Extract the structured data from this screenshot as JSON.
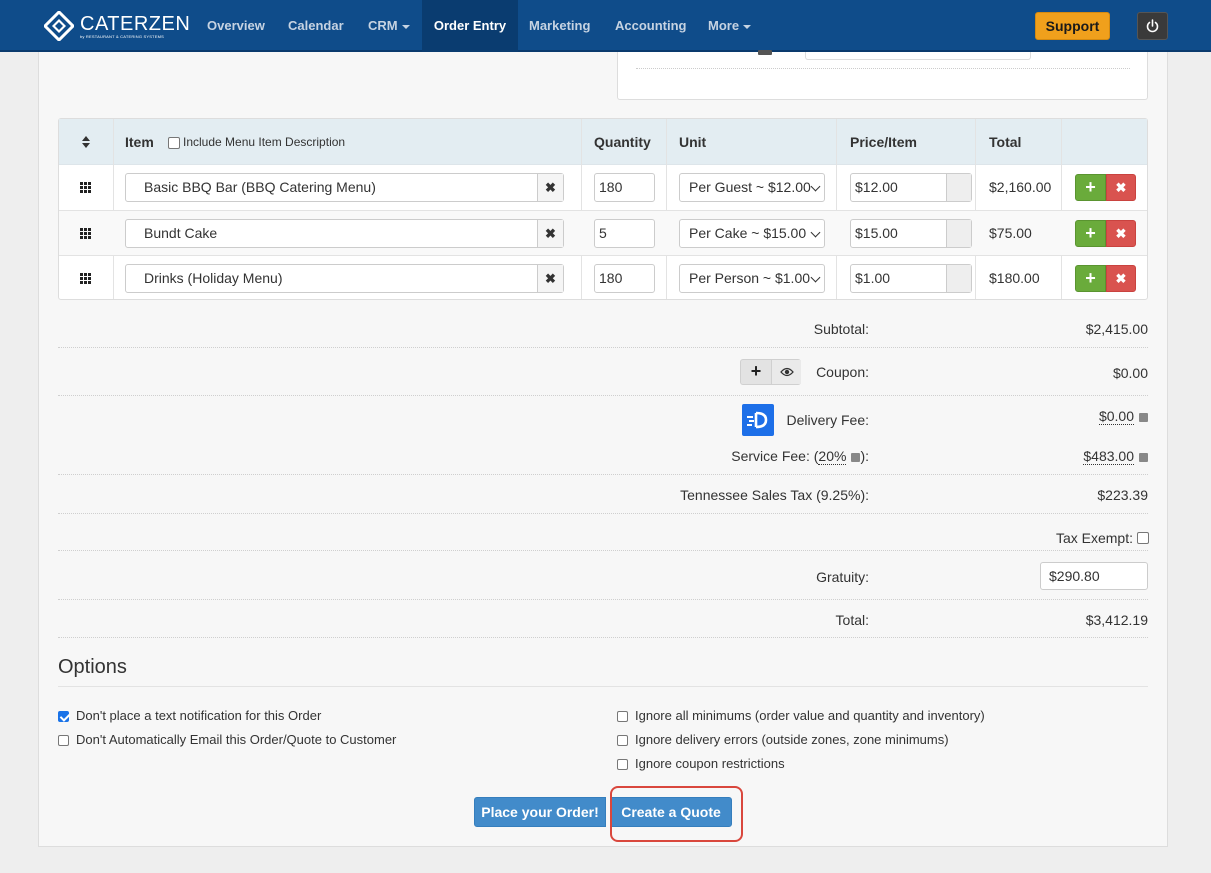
{
  "nav": {
    "brand": "CATERZEN",
    "brand_sub": "by RESTAURANT & CATERING SYSTEMS",
    "items": [
      {
        "label": "Overview"
      },
      {
        "label": "Calendar"
      },
      {
        "label": "CRM"
      },
      {
        "label": "Order Entry"
      },
      {
        "label": "Marketing"
      },
      {
        "label": "Accounting"
      },
      {
        "label": "More"
      }
    ],
    "active": "Order Entry",
    "support_label": "Support"
  },
  "table": {
    "headers": {
      "item": "Item",
      "include_desc": "Include Menu Item Description",
      "quantity": "Quantity",
      "unit": "Unit",
      "price": "Price/Item",
      "total": "Total"
    },
    "rows": [
      {
        "item": "Basic BBQ Bar (BBQ Catering Menu)",
        "quantity": "180",
        "unit": "Per Guest ~ $12.00",
        "price": "$12.00",
        "total": "$2,160.00"
      },
      {
        "item": "Bundt Cake",
        "quantity": "5",
        "unit": "Per Cake ~ $15.00",
        "price": "$15.00",
        "total": "$75.00"
      },
      {
        "item": "Drinks (Holiday Menu)",
        "quantity": "180",
        "unit": "Per Person ~ $1.00",
        "price": "$1.00",
        "total": "$180.00"
      }
    ]
  },
  "summary": {
    "subtotal_label": "Subtotal:",
    "subtotal": "$2,415.00",
    "coupon_label": "Coupon:",
    "coupon": "$0.00",
    "delivery_label": "Delivery Fee:",
    "delivery": "$0.00",
    "service_label_pre": "Service Fee: (",
    "service_pct": "20%",
    "service_label_post": "):",
    "service": "$483.00",
    "tax_label": "Tennessee Sales Tax (9.25%):",
    "tax": "$223.39",
    "tax_exempt_label": "Tax Exempt:",
    "gratuity_label": "Gratuity:",
    "gratuity": "$290.80",
    "total_label": "Total:",
    "total": "$3,412.19"
  },
  "options": {
    "title": "Options",
    "left": [
      {
        "label": "Don't place a text notification for this Order",
        "checked": true
      },
      {
        "label": "Don't Automatically Email this Order/Quote to Customer",
        "checked": false
      }
    ],
    "right": [
      {
        "label": "Ignore all minimums (order value and quantity and inventory)",
        "checked": false
      },
      {
        "label": "Ignore delivery errors (outside zones, zone minimums)",
        "checked": false
      },
      {
        "label": "Ignore coupon restrictions",
        "checked": false
      }
    ]
  },
  "actions": {
    "place_order": "Place your Order!",
    "create_quote": "Create a Quote"
  }
}
